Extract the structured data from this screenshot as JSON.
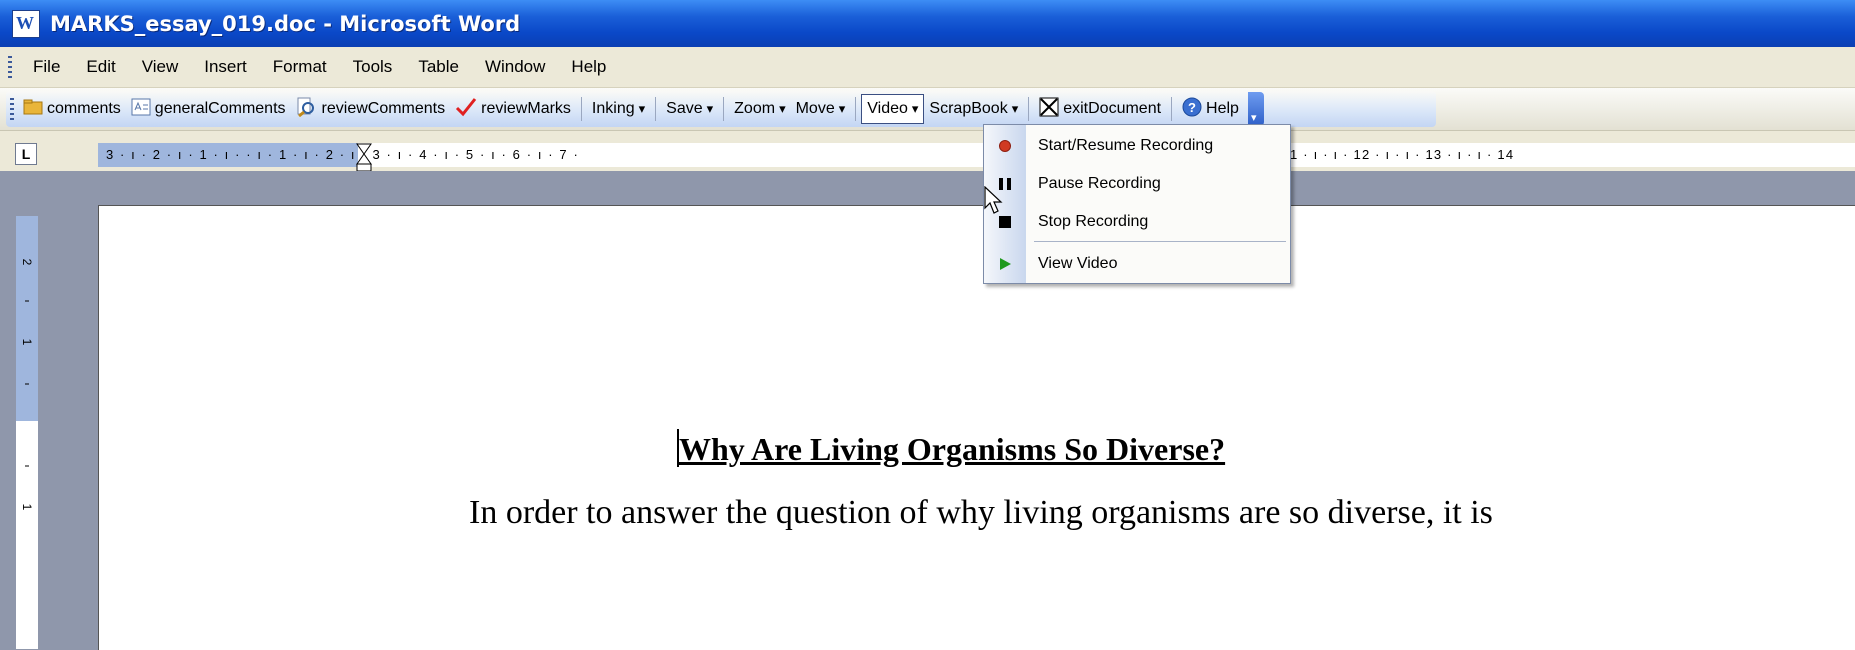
{
  "window": {
    "title": "MARKS_essay_019.doc - Microsoft Word",
    "icon": "word-doc-icon"
  },
  "menu": [
    "File",
    "Edit",
    "View",
    "Insert",
    "Format",
    "Tools",
    "Table",
    "Window",
    "Help"
  ],
  "toolbar": {
    "comments": "comments",
    "general_comments": "generalComments",
    "review_comments": "reviewComments",
    "review_marks": "reviewMarks",
    "inking": "Inking",
    "save": "Save",
    "zoom": "Zoom",
    "move": "Move",
    "video": "Video",
    "scrapbook": "ScrapBook",
    "exit_document": "exitDocument",
    "help": "Help"
  },
  "ruler": {
    "tab_selector": "L",
    "labels": "3 · ı · 2 · ı · 1 · ı ·   · ı · 1 · ı · 2 · ı · 3 · ı · 4 · ı · 5 · ı · 6 · ı · 7 ·",
    "labels_right": "1 · ı · ı · 12 · ı · ı · 13 · ı · ı · 14"
  },
  "video_menu": {
    "items": [
      {
        "label": "Start/Resume Recording",
        "icon": "record-icon",
        "color": "#d03a22"
      },
      {
        "label": "Pause Recording",
        "icon": "pause-icon"
      },
      {
        "label": "Stop Recording",
        "icon": "stop-icon"
      },
      {
        "label": "View Video",
        "icon": "play-icon",
        "color": "#1f9a1f"
      }
    ]
  },
  "document": {
    "title": "Why Are Living Organisms So Diverse?",
    "paragraph": "In order to answer the question of why living organisms are so diverse, it is"
  },
  "colors": {
    "titlebar": "#0a48c8",
    "chrome": "#ece9d8",
    "workspace": "#8f97ab",
    "review_mark": "#e02020"
  }
}
